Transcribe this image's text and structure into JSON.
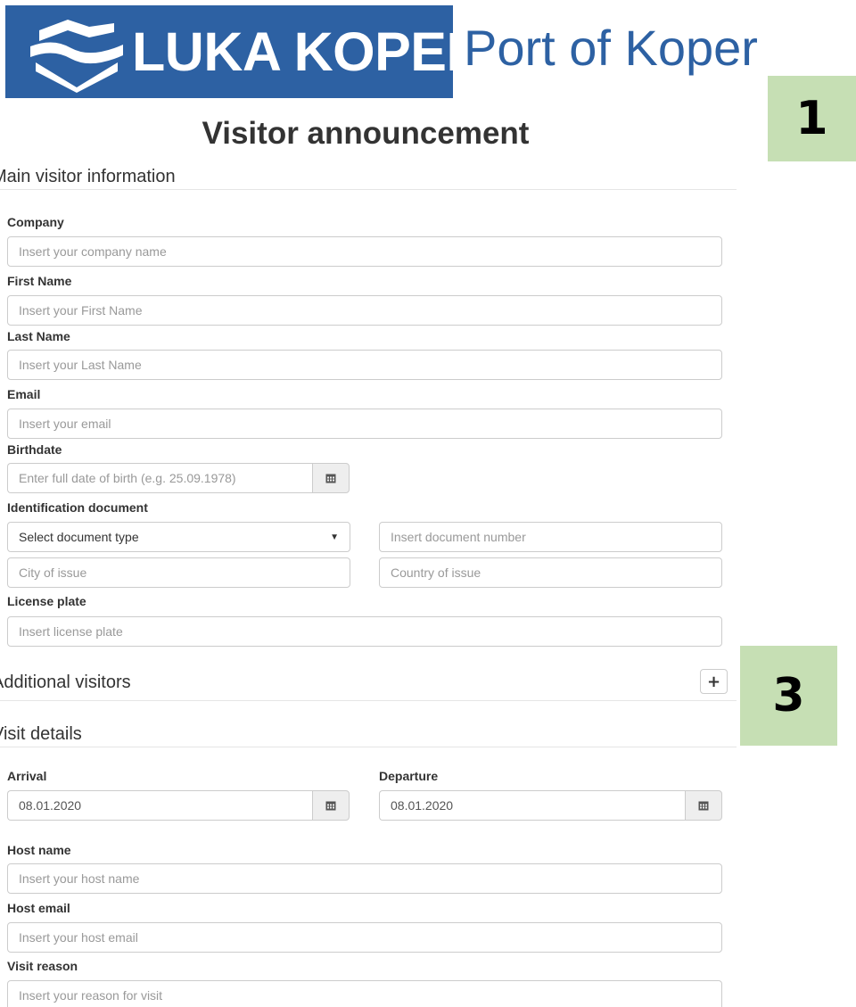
{
  "logo": {
    "brand": "LUKA KOPER",
    "subtitle": "Port of Koper"
  },
  "page_title": "Visitor announcement",
  "badges": {
    "first": "1",
    "second": "3"
  },
  "sections": {
    "main": "Main visitor information",
    "additional": "Additional visitors",
    "visit": "Visit details"
  },
  "form": {
    "company": {
      "label": "Company",
      "placeholder": "Insert your company name"
    },
    "first_name": {
      "label": "First Name",
      "placeholder": "Insert your First Name"
    },
    "last_name": {
      "label": "Last Name",
      "placeholder": "Insert your Last Name"
    },
    "email": {
      "label": "Email",
      "placeholder": "Insert your email"
    },
    "birthdate": {
      "label": "Birthdate",
      "placeholder": "Enter full date of birth (e.g. 25.09.1978)"
    },
    "id_document": {
      "label": "Identification document",
      "type_selected": "Select document type",
      "number_placeholder": "Insert document number",
      "city_placeholder": "City of issue",
      "country_placeholder": "Country of issue"
    },
    "license_plate": {
      "label": "License plate",
      "placeholder": "Insert license plate"
    },
    "additional_add": "+",
    "arrival": {
      "label": "Arrival",
      "value": "08.01.2020"
    },
    "departure": {
      "label": "Departure",
      "value": "08.01.2020"
    },
    "host_name": {
      "label": "Host name",
      "placeholder": "Insert your host name"
    },
    "host_email": {
      "label": "Host email",
      "placeholder": "Insert your host email"
    },
    "visit_reason": {
      "label": "Visit reason",
      "placeholder": "Insert your reason for visit"
    }
  },
  "colors": {
    "brand_blue": "#2d61a3",
    "badge_green": "#c6dfb4"
  }
}
